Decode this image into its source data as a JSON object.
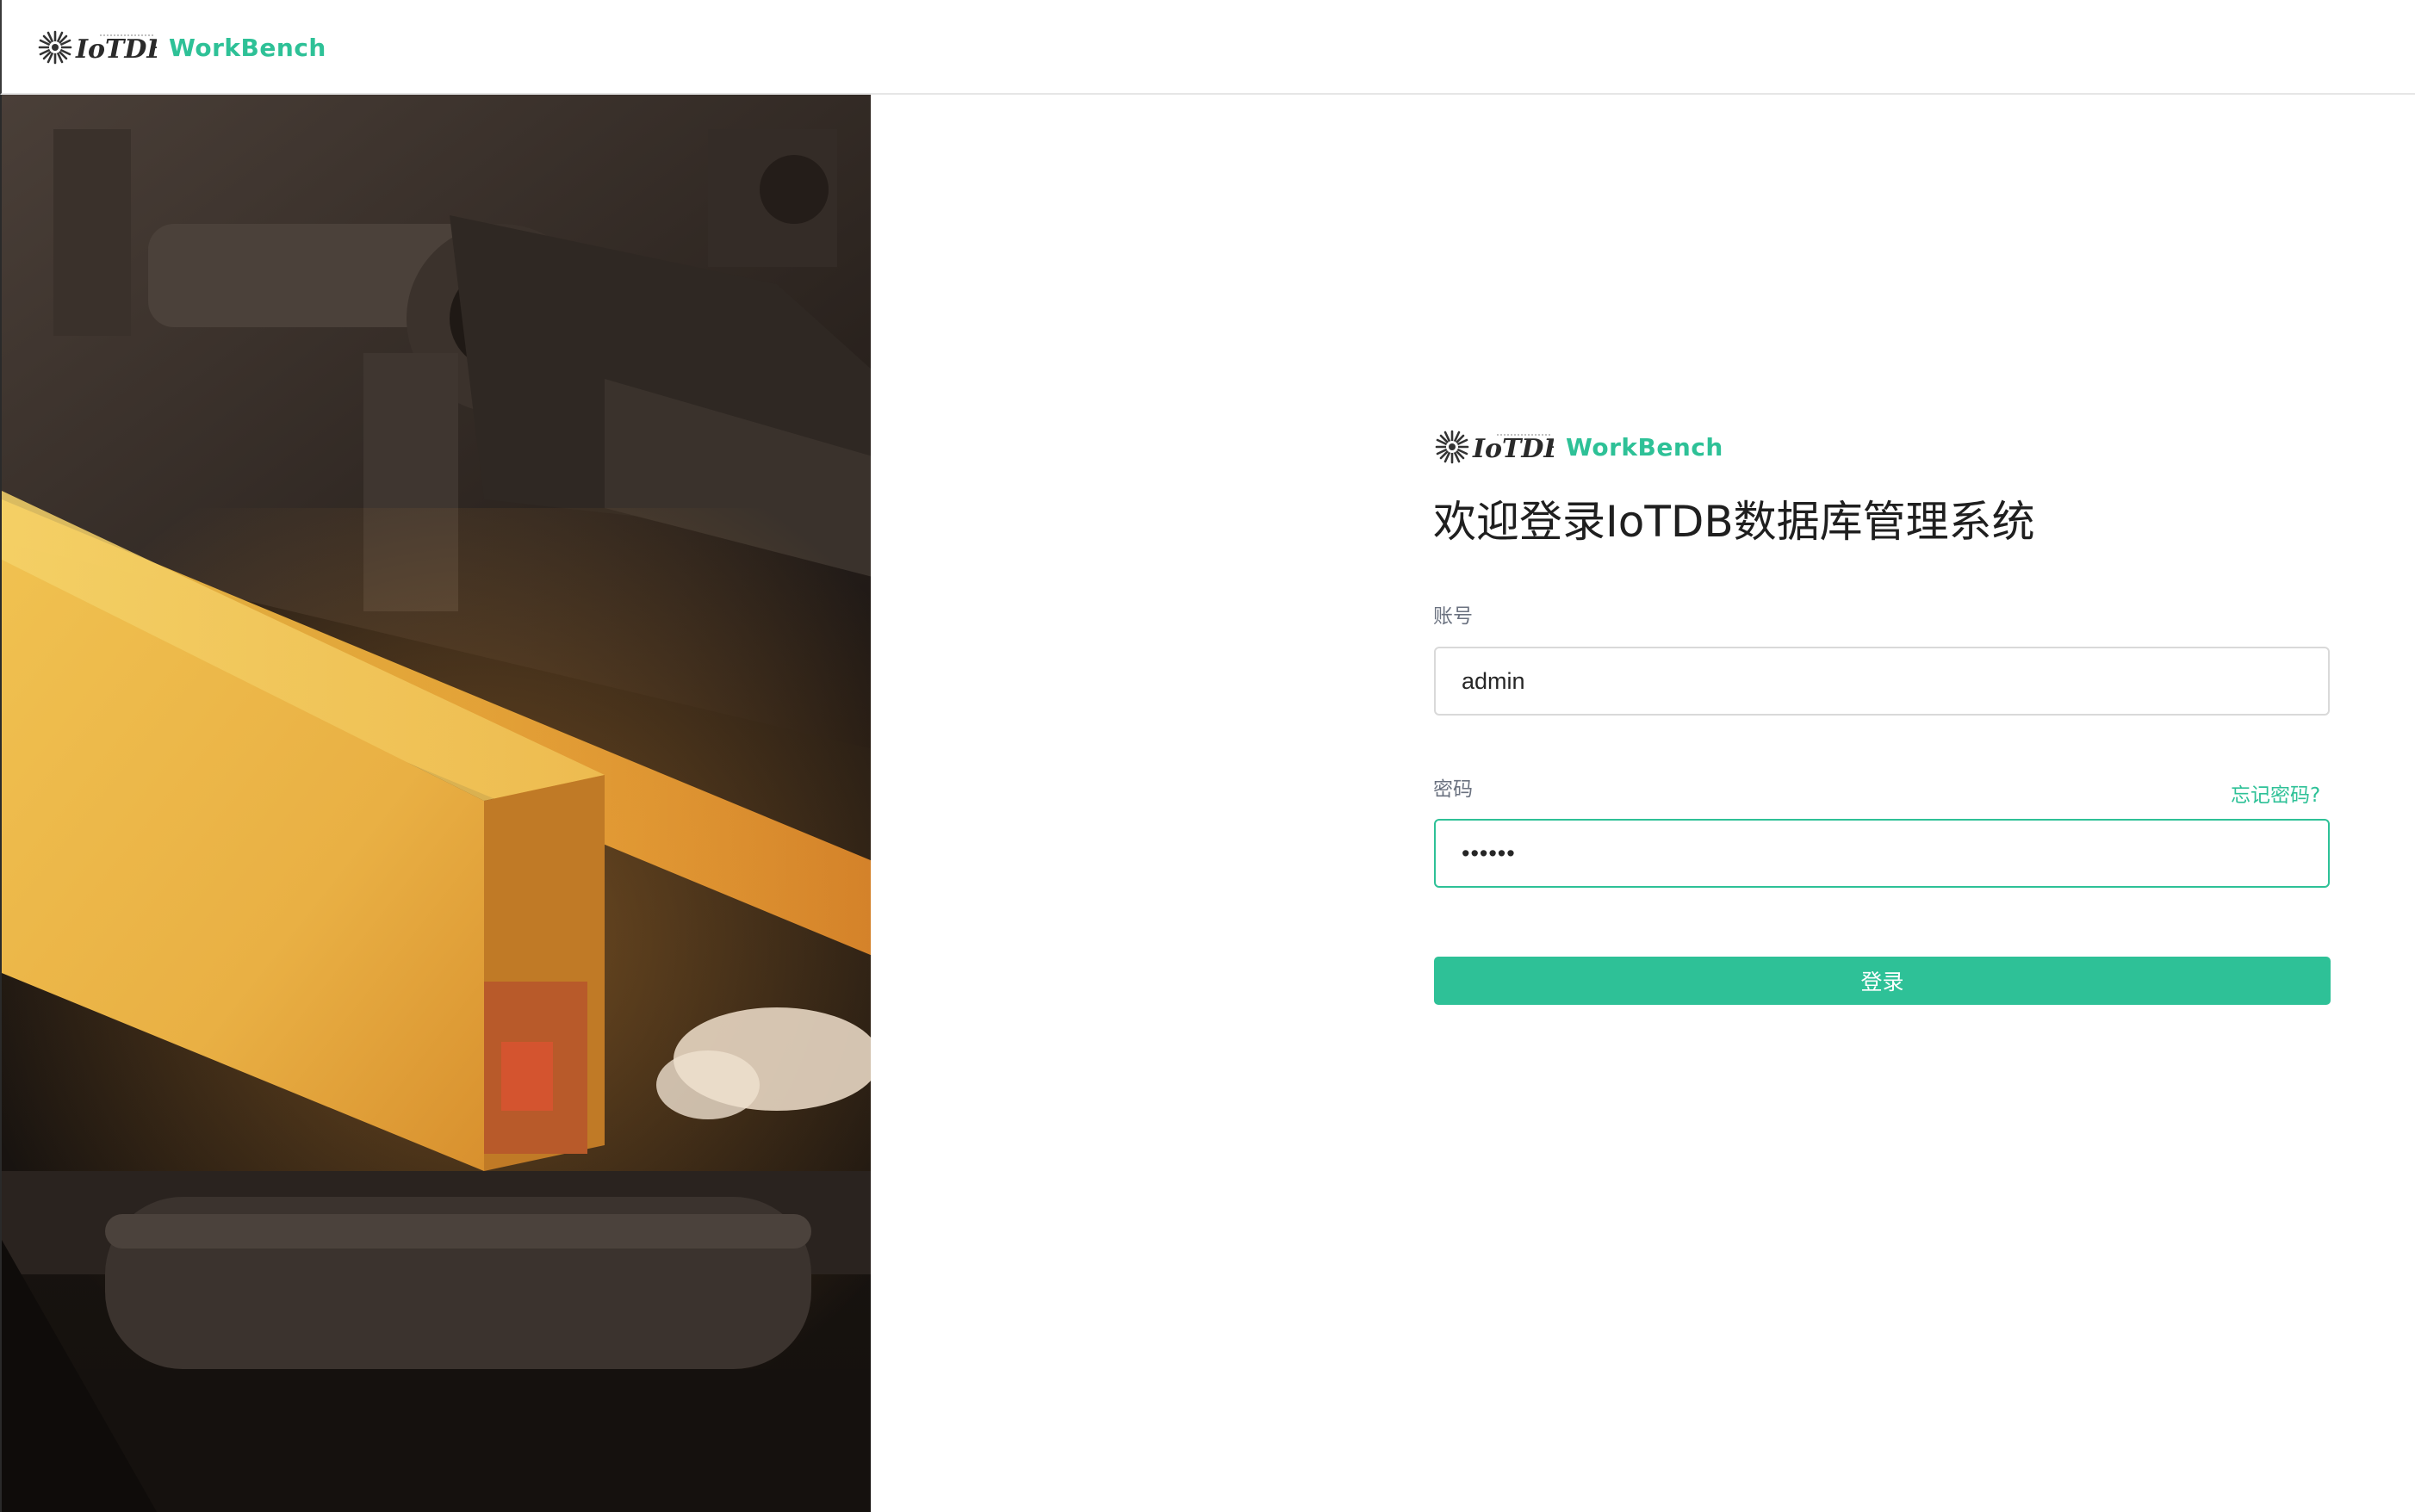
{
  "header": {
    "logo_text": "IoTDB",
    "product_name": "WorkBench"
  },
  "hero": {
    "image": "industrial-steel-mill-photo"
  },
  "login_form": {
    "logo_text": "IoTDB",
    "product_name": "WorkBench",
    "title": "欢迎登录IoTDB数据库管理系统",
    "account": {
      "label": "账号",
      "value": "admin"
    },
    "password": {
      "label": "密码",
      "value": "••••••",
      "forgot_link": "忘记密码?"
    },
    "submit_label": "登录"
  },
  "colors": {
    "accent": "#2ec197",
    "title": "#1f1f1f",
    "label": "#6b7280",
    "border": "#d9d9d9"
  },
  "icons": [
    "iotdb-logo-icon"
  ]
}
